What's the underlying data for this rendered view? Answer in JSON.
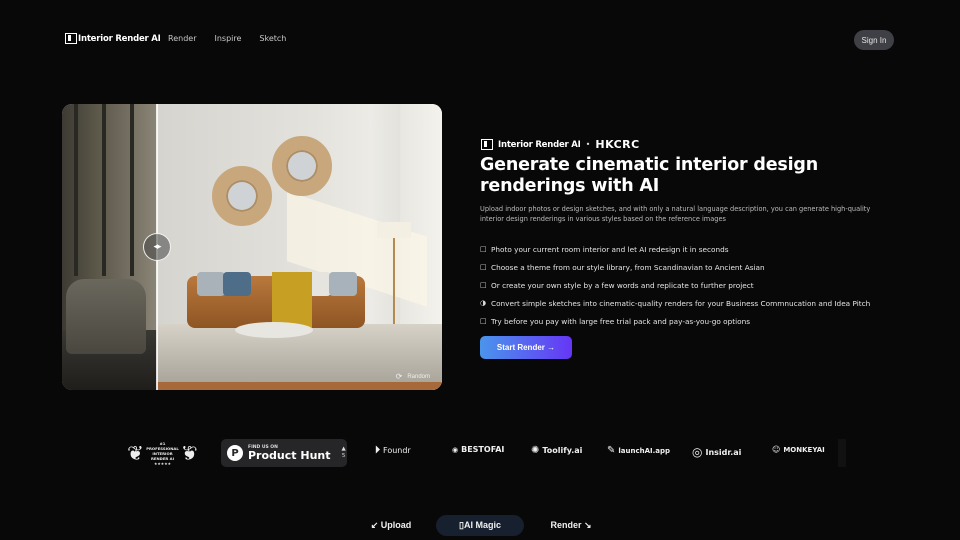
{
  "header": {
    "logo": "Interior Render AI",
    "nav": [
      {
        "label": "Render"
      },
      {
        "label": "Inspire"
      },
      {
        "label": "Sketch"
      }
    ],
    "signin_label": "Sign In"
  },
  "hero_image": {
    "slider_icon": "◂▸",
    "random_icon": "⟳",
    "random_label": "Random",
    "comparison_split": 0.25
  },
  "hero": {
    "brand_logo": "Interior Render AI",
    "brand_separator": "•",
    "brand_partner": "HKCRC",
    "headline": "Generate cinematic interior design renderings with AI",
    "subtitle": "Upload indoor photos or design sketches, and with only a natural language description, you can generate high-quality interior design renderings in various styles based on the reference images",
    "features": [
      {
        "icon": "□",
        "text": "Photo your current room interior and let AI redesign it in seconds"
      },
      {
        "icon": "□",
        "text": "Choose a theme from our style library, from Scandinavian to Ancient Asian"
      },
      {
        "icon": "□",
        "text": "Or create your own style by a few words and replicate to further project"
      },
      {
        "icon": "◑",
        "text": "Convert simple sketches into cinematic-quality renders for your Business Commnucation and Idea Pitch"
      },
      {
        "icon": "□",
        "text": "Try before you pay with large free trial pack and pay-as-you-go options"
      }
    ],
    "cta_label": "Start Render →"
  },
  "badges": {
    "award": {
      "line1": "#1 PROFESSIONAL",
      "line2": "INTERIOR RENDER AI",
      "stars": "★★★★★"
    },
    "product_hunt": {
      "small": "FIND US ON",
      "big": "Product Hunt",
      "upvote_icon": "▲",
      "votes": "5"
    },
    "partners": [
      {
        "icon": "⏵",
        "name": "Foundr"
      },
      {
        "icon": "◉",
        "name": "BESTOFAI"
      },
      {
        "icon": "✺",
        "name": "Toolify.ai"
      },
      {
        "icon": "✎",
        "name": "launchAI.app"
      },
      {
        "icon": "◎",
        "name": "Insidr.ai"
      },
      {
        "icon": "☺",
        "name": "MONKEYAI"
      }
    ]
  },
  "tabs": [
    {
      "label": "↙ Upload"
    },
    {
      "label": "▯AI Magic"
    },
    {
      "label": "Render ↘"
    }
  ]
}
